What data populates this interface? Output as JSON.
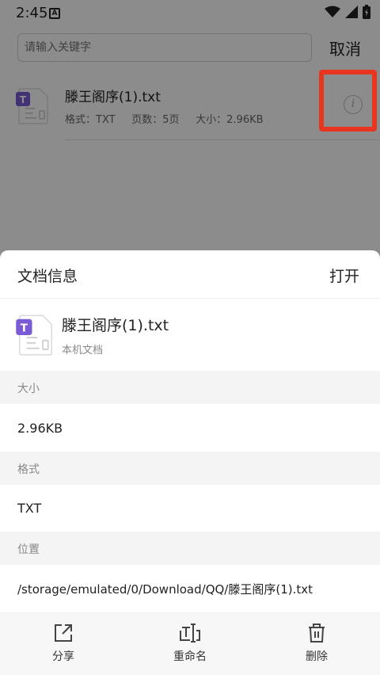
{
  "status_bar": {
    "time": "2:45",
    "notification_badge": "A"
  },
  "search": {
    "placeholder": "请输入关键字",
    "cancel_label": "取消"
  },
  "result": {
    "title": "滕王阁序(1).txt",
    "meta": "格式：TXT     页数：5页     大小：2.96KB",
    "icon_letter": "T"
  },
  "sheet": {
    "title": "文档信息",
    "open_label": "打开",
    "file_name": "滕王阁序(1).txt",
    "file_source": "本机文档",
    "icon_letter": "T",
    "size_label": "大小",
    "size_value": "2.96KB",
    "format_label": "格式",
    "format_value": "TXT",
    "location_label": "位置",
    "location_value": "/storage/emulated/0/Download/QQ/滕王阁序(1).txt"
  },
  "actions": [
    {
      "label": "分享",
      "icon": "share-icon"
    },
    {
      "label": "重命名",
      "icon": "rename-icon"
    },
    {
      "label": "删除",
      "icon": "trash-icon"
    }
  ],
  "colors": {
    "highlight": "#e8351f",
    "doc_badge": "#7b5ad6"
  }
}
